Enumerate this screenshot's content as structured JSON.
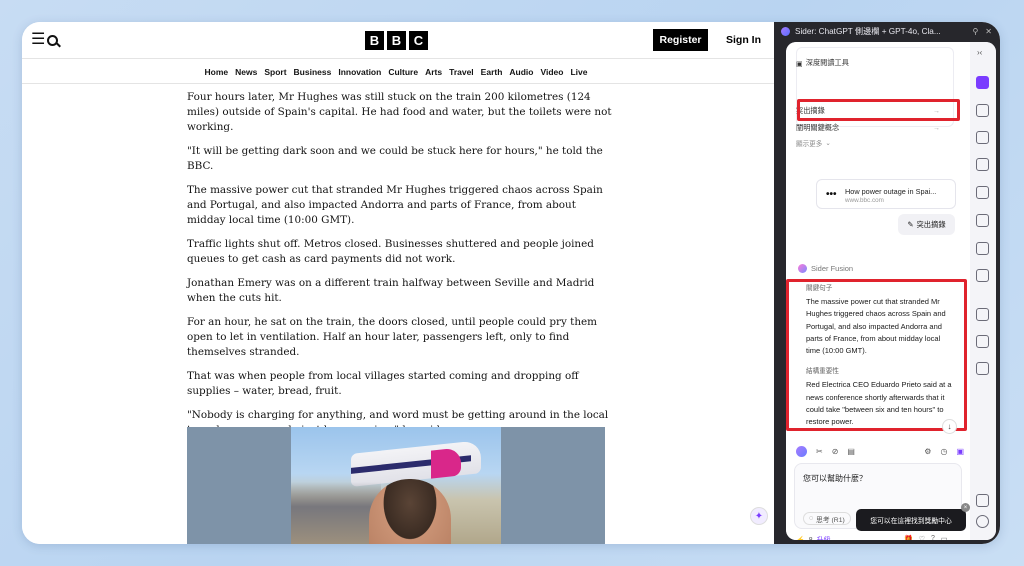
{
  "bbc": {
    "logo_letters": [
      "B",
      "B",
      "C"
    ],
    "register_label": "Register",
    "signin_label": "Sign In",
    "nav": [
      "Home",
      "News",
      "Sport",
      "Business",
      "Innovation",
      "Culture",
      "Arts",
      "Travel",
      "Earth",
      "Audio",
      "Video",
      "Live"
    ],
    "paragraphs": [
      "Four hours later, Mr Hughes was still stuck on the train 200 kilometres (124 miles) outside of Spain's capital. He had food and water, but the toilets were not working.",
      "\"It will be getting dark soon and we could be stuck here for hours,\" he told the BBC.",
      "The massive power cut that stranded Mr Hughes triggered chaos across Spain and Portugal, and also impacted Andorra and parts of France, from about midday local time (10:00 GMT).",
      "Traffic lights shut off. Metros closed. Businesses shuttered and people joined queues to get cash as card payments did not work.",
      "Jonathan Emery was on a different train halfway between Seville and Madrid when the cuts hit.",
      "For an hour, he sat on the train, the doors closed, until people could pry them open to let in ventilation. Half an hour later, passengers left, only to find themselves stranded.",
      "That was when people from local villages started coming and dropping off supplies – water, bread, fruit.",
      "\"Nobody is charging for anything, and word must be getting around in the local town because people just keep coming,\" he said."
    ]
  },
  "sider": {
    "window_title": "Sider: ChatGPT 側邊欄 + GPT-4o, Cla...",
    "tools": {
      "deep_read": "深度閱讀工具",
      "highlight": "突出摘錄",
      "key_concepts": "闡明關鍵概念",
      "show_more": "顯示更多"
    },
    "link_card": {
      "title": "How power outage in Spai...",
      "url": "www.bbc.com"
    },
    "user_pill": "突出摘錄",
    "bot_name": "Sider Fusion",
    "answer": {
      "cap1": "關鍵句子",
      "text1": "The massive power cut that stranded Mr Hughes triggered chaos across Spain and Portugal, and also impacted Andorra and parts of France, from about midday local time (10:00 GMT).",
      "cap2": "結構重要性",
      "text2": "Red Electrica CEO Eduardo Prieto said at a news conference shortly afterwards that it could take \"between six and ten hours\" to restore power."
    },
    "input_placeholder": "您可以幫助什麼？",
    "think_label": "思考 (R1)",
    "tooltip": "您可以在這裡找到獎勵中心",
    "credits_num": "8",
    "upgrade_label": "升級",
    "accent": "#7a3cff",
    "highlight_color": "#e0232d"
  }
}
